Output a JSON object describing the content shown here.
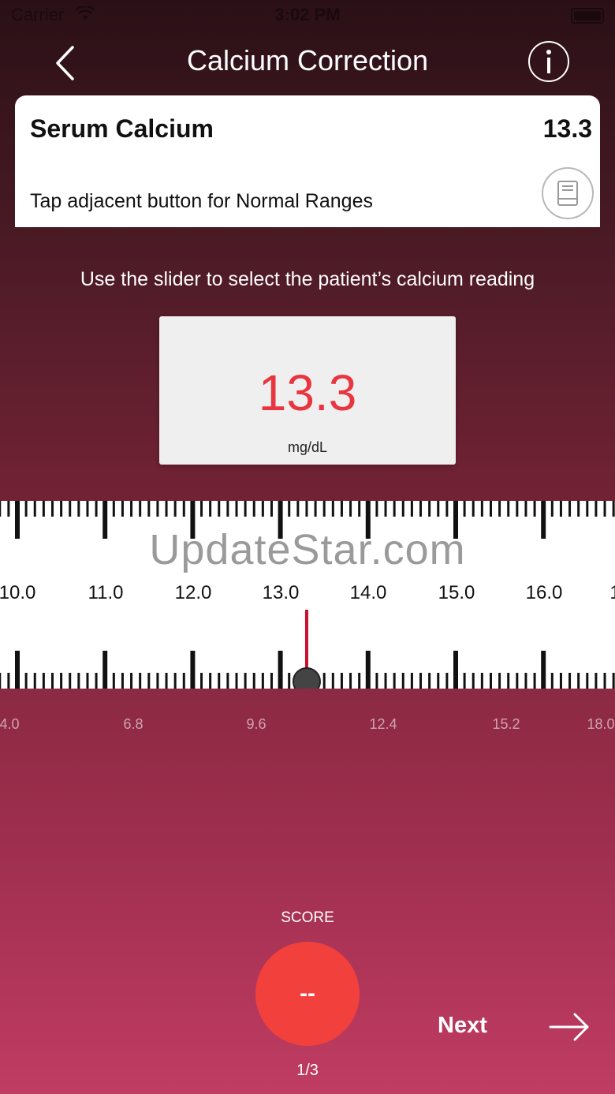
{
  "status_bar": {
    "carrier": "Carrier",
    "time": "3:02 PM"
  },
  "nav": {
    "title": "Calcium Correction"
  },
  "card": {
    "title": "Serum Calcium",
    "value": "13.3",
    "subtitle": "Tap adjacent button for Normal Ranges"
  },
  "instruction": "Use the slider to select the patient’s calcium reading",
  "reading": {
    "value": "13.3",
    "unit": "mg/dL"
  },
  "ruler": {
    "labels": [
      "10.0",
      "11.0",
      "12.0",
      "13.0",
      "14.0",
      "15.0",
      "16.0",
      "1"
    ]
  },
  "watermark": "UpdateStar.com",
  "slider": {
    "labels": [
      "4.0",
      "6.8",
      "9.6",
      "12.4",
      "15.2",
      "18.0"
    ],
    "value": 13.3
  },
  "score": {
    "label": "SCORE",
    "value": "--",
    "progress": "1/3"
  },
  "next": {
    "label": "Next"
  },
  "colors": {
    "accent_red": "#e8353f",
    "score_red": "#f2403d",
    "slider_line": "#c8102e"
  }
}
